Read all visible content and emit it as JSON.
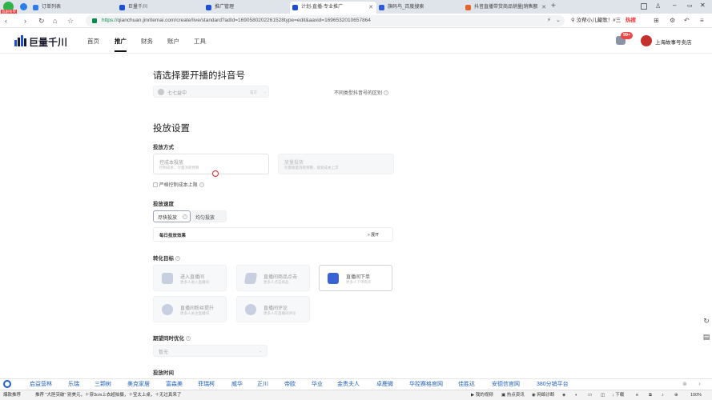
{
  "browser": {
    "tabs": [
      {
        "label": "订单列表",
        "color": "#2b7de9"
      },
      {
        "label": "巨量千川",
        "color": "#1a4fd6"
      },
      {
        "label": "推广管理",
        "color": "#1a4fd6"
      },
      {
        "label": "计划-直播-专业推广",
        "color": "#1a4fd6"
      },
      {
        "label": "旗码鸟_百度搜索",
        "color": "#2b5bd6"
      },
      {
        "label": "抖音直播带货商品销量|销售额|排行榜",
        "color": "#e8632b"
      }
    ],
    "url_secure": "https://",
    "url_rest": "qianchuan.jinritemai.com/create/live/standard?adId=1690580202261528type=edit&aavid=1696532010657864",
    "search_text": "汝帮小儿藏歌！#三",
    "hot_label": "热搜",
    "corner_badge": "追剧有奖"
  },
  "app": {
    "logo": "巨量千川",
    "nav": [
      "首页",
      "推广",
      "财务",
      "账户",
      "工具"
    ],
    "active_nav": "推广",
    "message_badge": "99+",
    "account_name": "上海故事号卖店"
  },
  "section_account": {
    "title": "请选择要开播的抖音号",
    "selected_account": "七七益中",
    "selected_tag": "官方",
    "help_link": "不同类型抖音号的区别"
  },
  "section_delivery": {
    "title": "投放设置",
    "method_label": "投放方式",
    "method_options": [
      {
        "title": "控成本投放",
        "desc": "控制成本，尽量消耗预算"
      },
      {
        "title": "放量投放",
        "desc": "尽量跑量消耗预算，接受成本上浮"
      }
    ],
    "strict_cost_label": "严格控制成本上限",
    "speed_label": "投放速度",
    "speed_options": [
      "尽快投放",
      "均匀投放"
    ],
    "daily_label": "每日投放效果",
    "expand_label": "展开",
    "goal_label": "转化目标",
    "goals": [
      {
        "title": "进入直播间",
        "desc": "更多人进入直播间",
        "color": "#b9c3d6"
      },
      {
        "title": "直播间商品点击",
        "desc": "更多人点击商品",
        "color": "#b9c3d6"
      },
      {
        "title": "直播间下单",
        "desc": "更多人下单购买",
        "color": "#3b63d6"
      },
      {
        "title": "直播间粉丝提升",
        "desc": "更多人关注直播间",
        "color": "#b9c3d6"
      },
      {
        "title": "直播间评论",
        "desc": "更多人在直播间评论",
        "color": "#b9c3d6"
      }
    ],
    "deep_label": "期望同时优化",
    "deep_value": "暂无",
    "time_label": "投放时间"
  },
  "bookmarks": [
    "启益营林",
    "乐瑞",
    "三颗树",
    "美克家居",
    "富森美",
    "菲瑞柯",
    "威华",
    "正川",
    "帝欧",
    "华业",
    "金贵夫人",
    "卓鹿微",
    "华控赛格官网",
    "佳胜达",
    "安德信官网",
    "380分销平台"
  ],
  "status": {
    "news_left": "爆款推荐",
    "news_text": "推荐 \"大胆突破\" 别美元，＋穿3cm上衣超拍摄，＋宝太上桌，＋无过真来了",
    "items": [
      "我的视频",
      "热点资讯",
      "网络诊断",
      "下载"
    ],
    "zoom": "100%"
  }
}
